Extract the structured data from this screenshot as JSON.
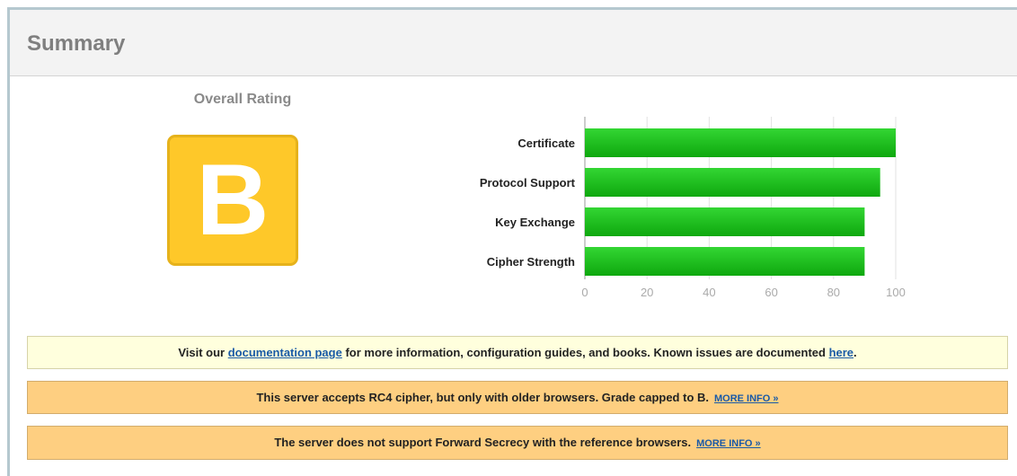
{
  "summary": {
    "title": "Summary"
  },
  "overall_rating": {
    "label": "Overall Rating",
    "grade": "B"
  },
  "chart_data": {
    "type": "bar",
    "orientation": "horizontal",
    "categories": [
      "Certificate",
      "Protocol Support",
      "Key Exchange",
      "Cipher Strength"
    ],
    "values": [
      100,
      95,
      90,
      90
    ],
    "xlim": [
      0,
      100
    ],
    "xticks": [
      0,
      20,
      40,
      60,
      80,
      100
    ],
    "grid": true,
    "bar_color": "#1fbf1f"
  },
  "notices": {
    "docs": {
      "text_before": "Visit our ",
      "link1": "documentation page",
      "text_middle": " for more information, configuration guides, and books. Known issues are documented ",
      "link2": "here",
      "text_after": "."
    },
    "rc4": {
      "text": "This server accepts RC4 cipher, but only with older browsers. Grade capped to B.",
      "more": "MORE INFO »"
    },
    "fs": {
      "text": "The server does not support Forward Secrecy with the reference browsers.",
      "more": "MORE INFO »"
    }
  },
  "colors": {
    "grade_fill": "#fec829",
    "notice_info_bg": "#ffffdd",
    "notice_warn_bg": "#fecf81",
    "link": "#1a5aa6"
  }
}
